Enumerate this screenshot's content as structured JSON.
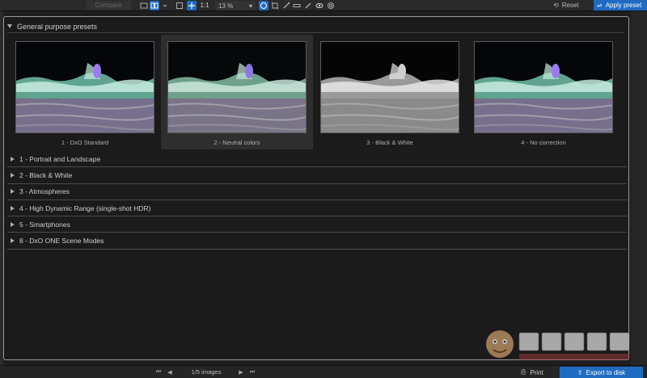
{
  "toolbar": {
    "compare_label": "Compare",
    "zoom_fit_label": "1:1",
    "zoom_value": "13 %",
    "reset_label": "Reset",
    "apply_preset_label": "Apply preset"
  },
  "panel": {
    "section_title": "General purpose presets",
    "presets": [
      {
        "label": "1 - DxO Standard",
        "style": "color",
        "selected": false
      },
      {
        "label": "2 - Neutral colors",
        "style": "neutral",
        "selected": true
      },
      {
        "label": "3 - Black & White",
        "style": "bw",
        "selected": false
      },
      {
        "label": "4 - No correction",
        "style": "color",
        "selected": false
      }
    ],
    "groups": [
      {
        "label": "1 - Portrait and Landscape"
      },
      {
        "label": "2 - Black & White"
      },
      {
        "label": "3 - Atmospheres"
      },
      {
        "label": "4 - High Dynamic Range (single-shot HDR)"
      },
      {
        "label": "5 - Smartphones"
      },
      {
        "label": "8 - DxO ONE Scene Modes"
      }
    ]
  },
  "bottombar": {
    "image_count": "1/5 images",
    "print_label": "Print",
    "export_label": "Export to disk"
  },
  "colors": {
    "accent": "#1f6bc2",
    "panel_bg": "#1b1b1b",
    "selected_bg": "#2e2e2e"
  }
}
